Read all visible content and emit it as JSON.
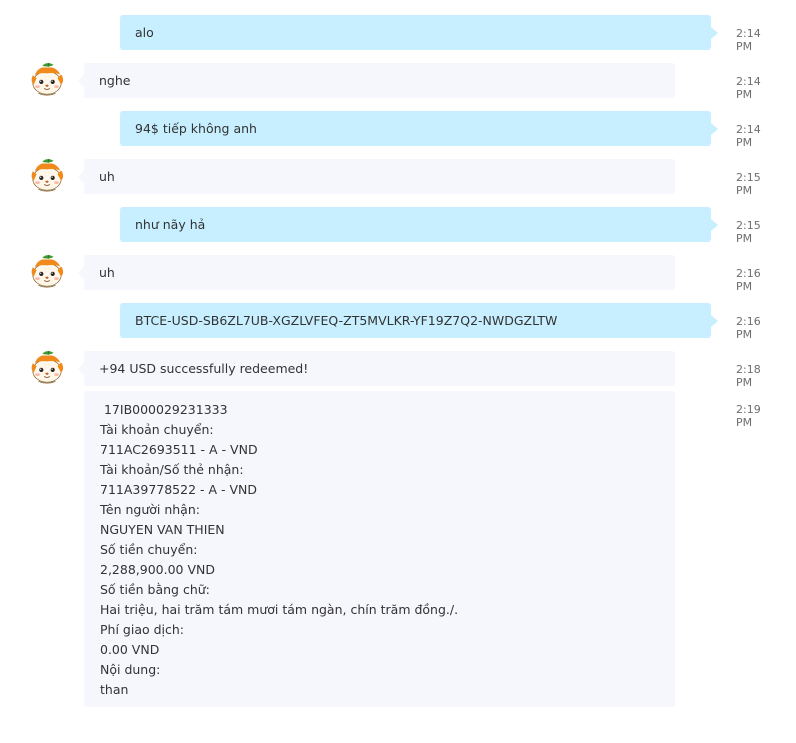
{
  "messages": [
    {
      "text": "alo",
      "time": "2:14 PM"
    },
    {
      "text": "nghe",
      "time": "2:14 PM"
    },
    {
      "text": "94$ tiếp không anh",
      "time": "2:14 PM"
    },
    {
      "text": "uh",
      "time": "2:15 PM"
    },
    {
      "text": "như nãy hả",
      "time": "2:15 PM"
    },
    {
      "text": "uh",
      "time": "2:16 PM"
    },
    {
      "text": "BTCE-USD-SB6ZL7UB-XGZLVFEQ-ZT5MVLKR-YF19Z7Q2-NWDGZLTW",
      "time": "2:16 PM"
    },
    {
      "text": "+94 USD successfully redeemed!",
      "time": "2:18 PM"
    }
  ],
  "transfer_message": {
    "time": "2:19 PM",
    "lines": [
      " 17IB000029231333",
      "Tài khoản chuyển:",
      "711AC2693511 - A - VND",
      "Tài khoản/Số thẻ nhận:",
      "711A39778522 - A - VND",
      "Tên người nhận:",
      "NGUYEN VAN THIEN",
      "Số tiền chuyển:",
      "2,288,900.00 VND",
      "Số tiền bằng chữ:",
      "Hai triệu, hai trăm tám mươi tám ngàn, chín trăm đồng./.",
      "Phí giao dịch:",
      "0.00 VND",
      "Nội dung:",
      "than"
    ]
  },
  "avatar_icon": "hamster-avatar-icon",
  "colors": {
    "outgoing_bubble": "#c7efff",
    "incoming_bubble": "#f6f6fd",
    "timestamp": "#6d6d6d"
  }
}
